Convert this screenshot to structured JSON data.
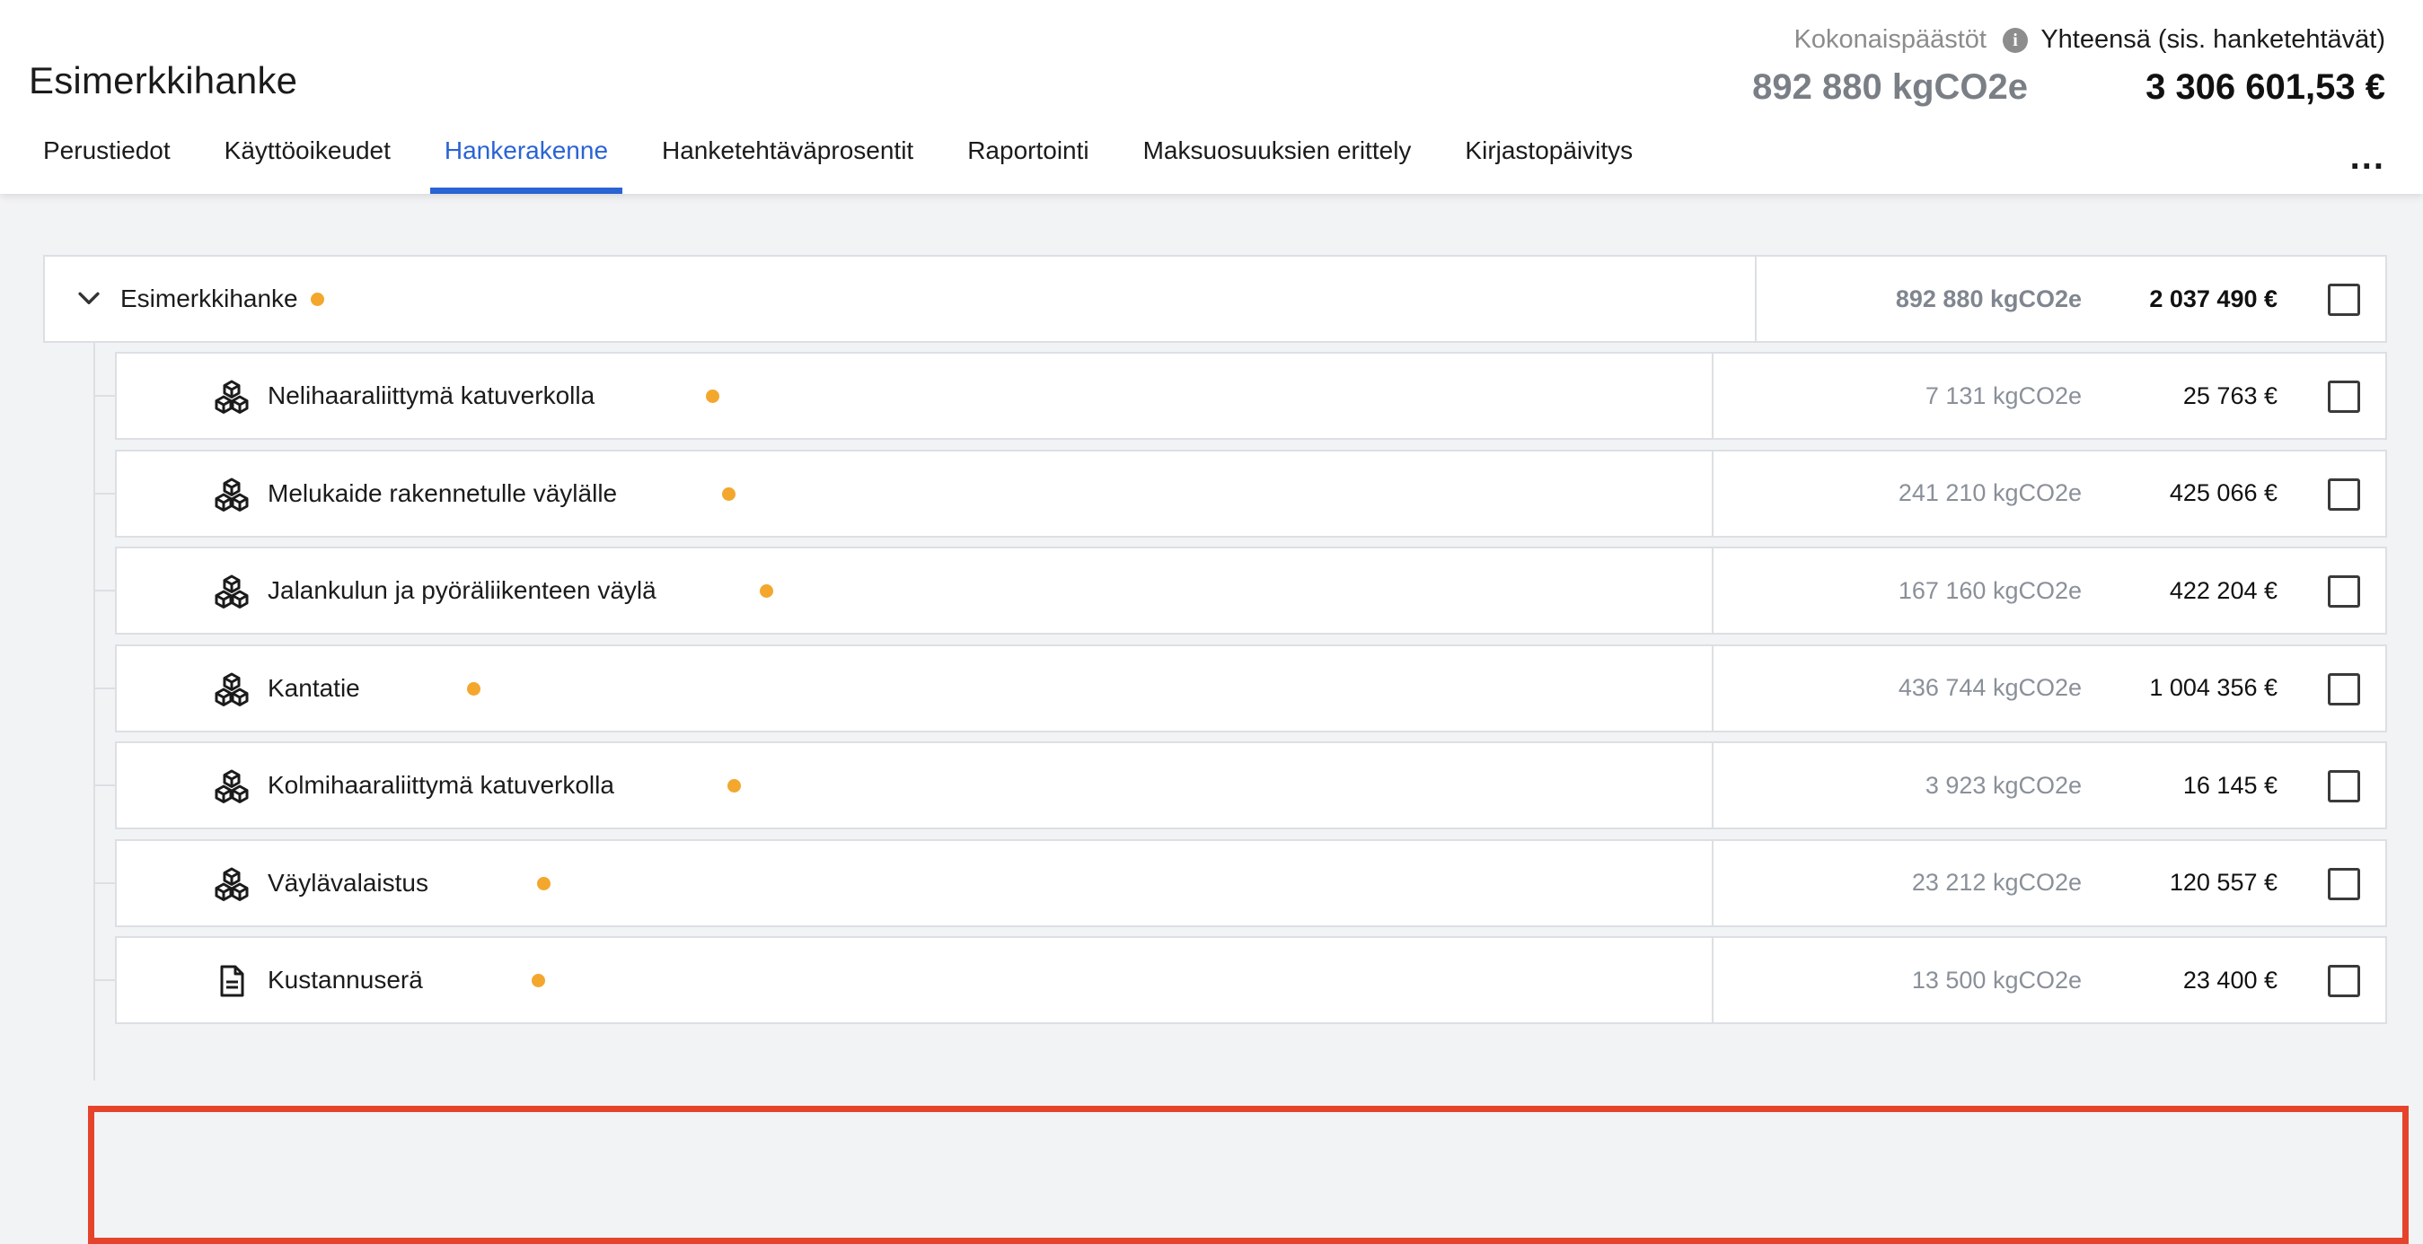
{
  "header": {
    "project_title": "Esimerkkihanke",
    "emissions_label": "Kokonaispäästöt",
    "emissions_value": "892 880 kgCO2e",
    "total_label": "Yhteensä (sis. hanketehtävät)",
    "total_value": "3 306 601,53 €",
    "more_label": "..."
  },
  "tabs": [
    {
      "label": "Perustiedot",
      "active": false
    },
    {
      "label": "Käyttöoikeudet",
      "active": false
    },
    {
      "label": "Hankerakenne",
      "active": true
    },
    {
      "label": "Hanketehtäväprosentit",
      "active": false
    },
    {
      "label": "Raportointi",
      "active": false
    },
    {
      "label": "Maksuosuuksien erittely",
      "active": false
    },
    {
      "label": "Kirjastopäivitys",
      "active": false
    }
  ],
  "tree": {
    "root": {
      "label": "Esimerkkihanke",
      "emissions": "892 880 kgCO2e",
      "cost": "2 037 490 €",
      "checked": false
    },
    "children": [
      {
        "label": "Nelihaaraliittymä katuverkolla",
        "icon": "blocks-icon",
        "emissions": "7 131 kgCO2e",
        "cost": "25 763 €",
        "checked": false
      },
      {
        "label": "Melukaide rakennetulle väylälle",
        "icon": "blocks-icon",
        "emissions": "241 210 kgCO2e",
        "cost": "425 066 €",
        "checked": false
      },
      {
        "label": "Jalankulun ja pyöräliikenteen väylä",
        "icon": "blocks-icon",
        "emissions": "167 160 kgCO2e",
        "cost": "422 204 €",
        "checked": false
      },
      {
        "label": "Kantatie",
        "icon": "blocks-icon",
        "emissions": "436 744 kgCO2e",
        "cost": "1 004 356 €",
        "checked": false
      },
      {
        "label": "Kolmihaaraliittymä katuverkolla",
        "icon": "blocks-icon",
        "emissions": "3 923 kgCO2e",
        "cost": "16 145 €",
        "checked": false
      },
      {
        "label": "Väylävalaistus",
        "icon": "blocks-icon",
        "emissions": "23 212 kgCO2e",
        "cost": "120 557 €",
        "checked": false
      },
      {
        "label": "Kustannuserä",
        "icon": "document-icon",
        "emissions": "13 500 kgCO2e",
        "cost": "23 400 €",
        "checked": false,
        "highlighted": true
      }
    ]
  },
  "colors": {
    "accent": "#2a63d4",
    "status_dot": "#f3a72d",
    "highlight": "#e5432c"
  }
}
